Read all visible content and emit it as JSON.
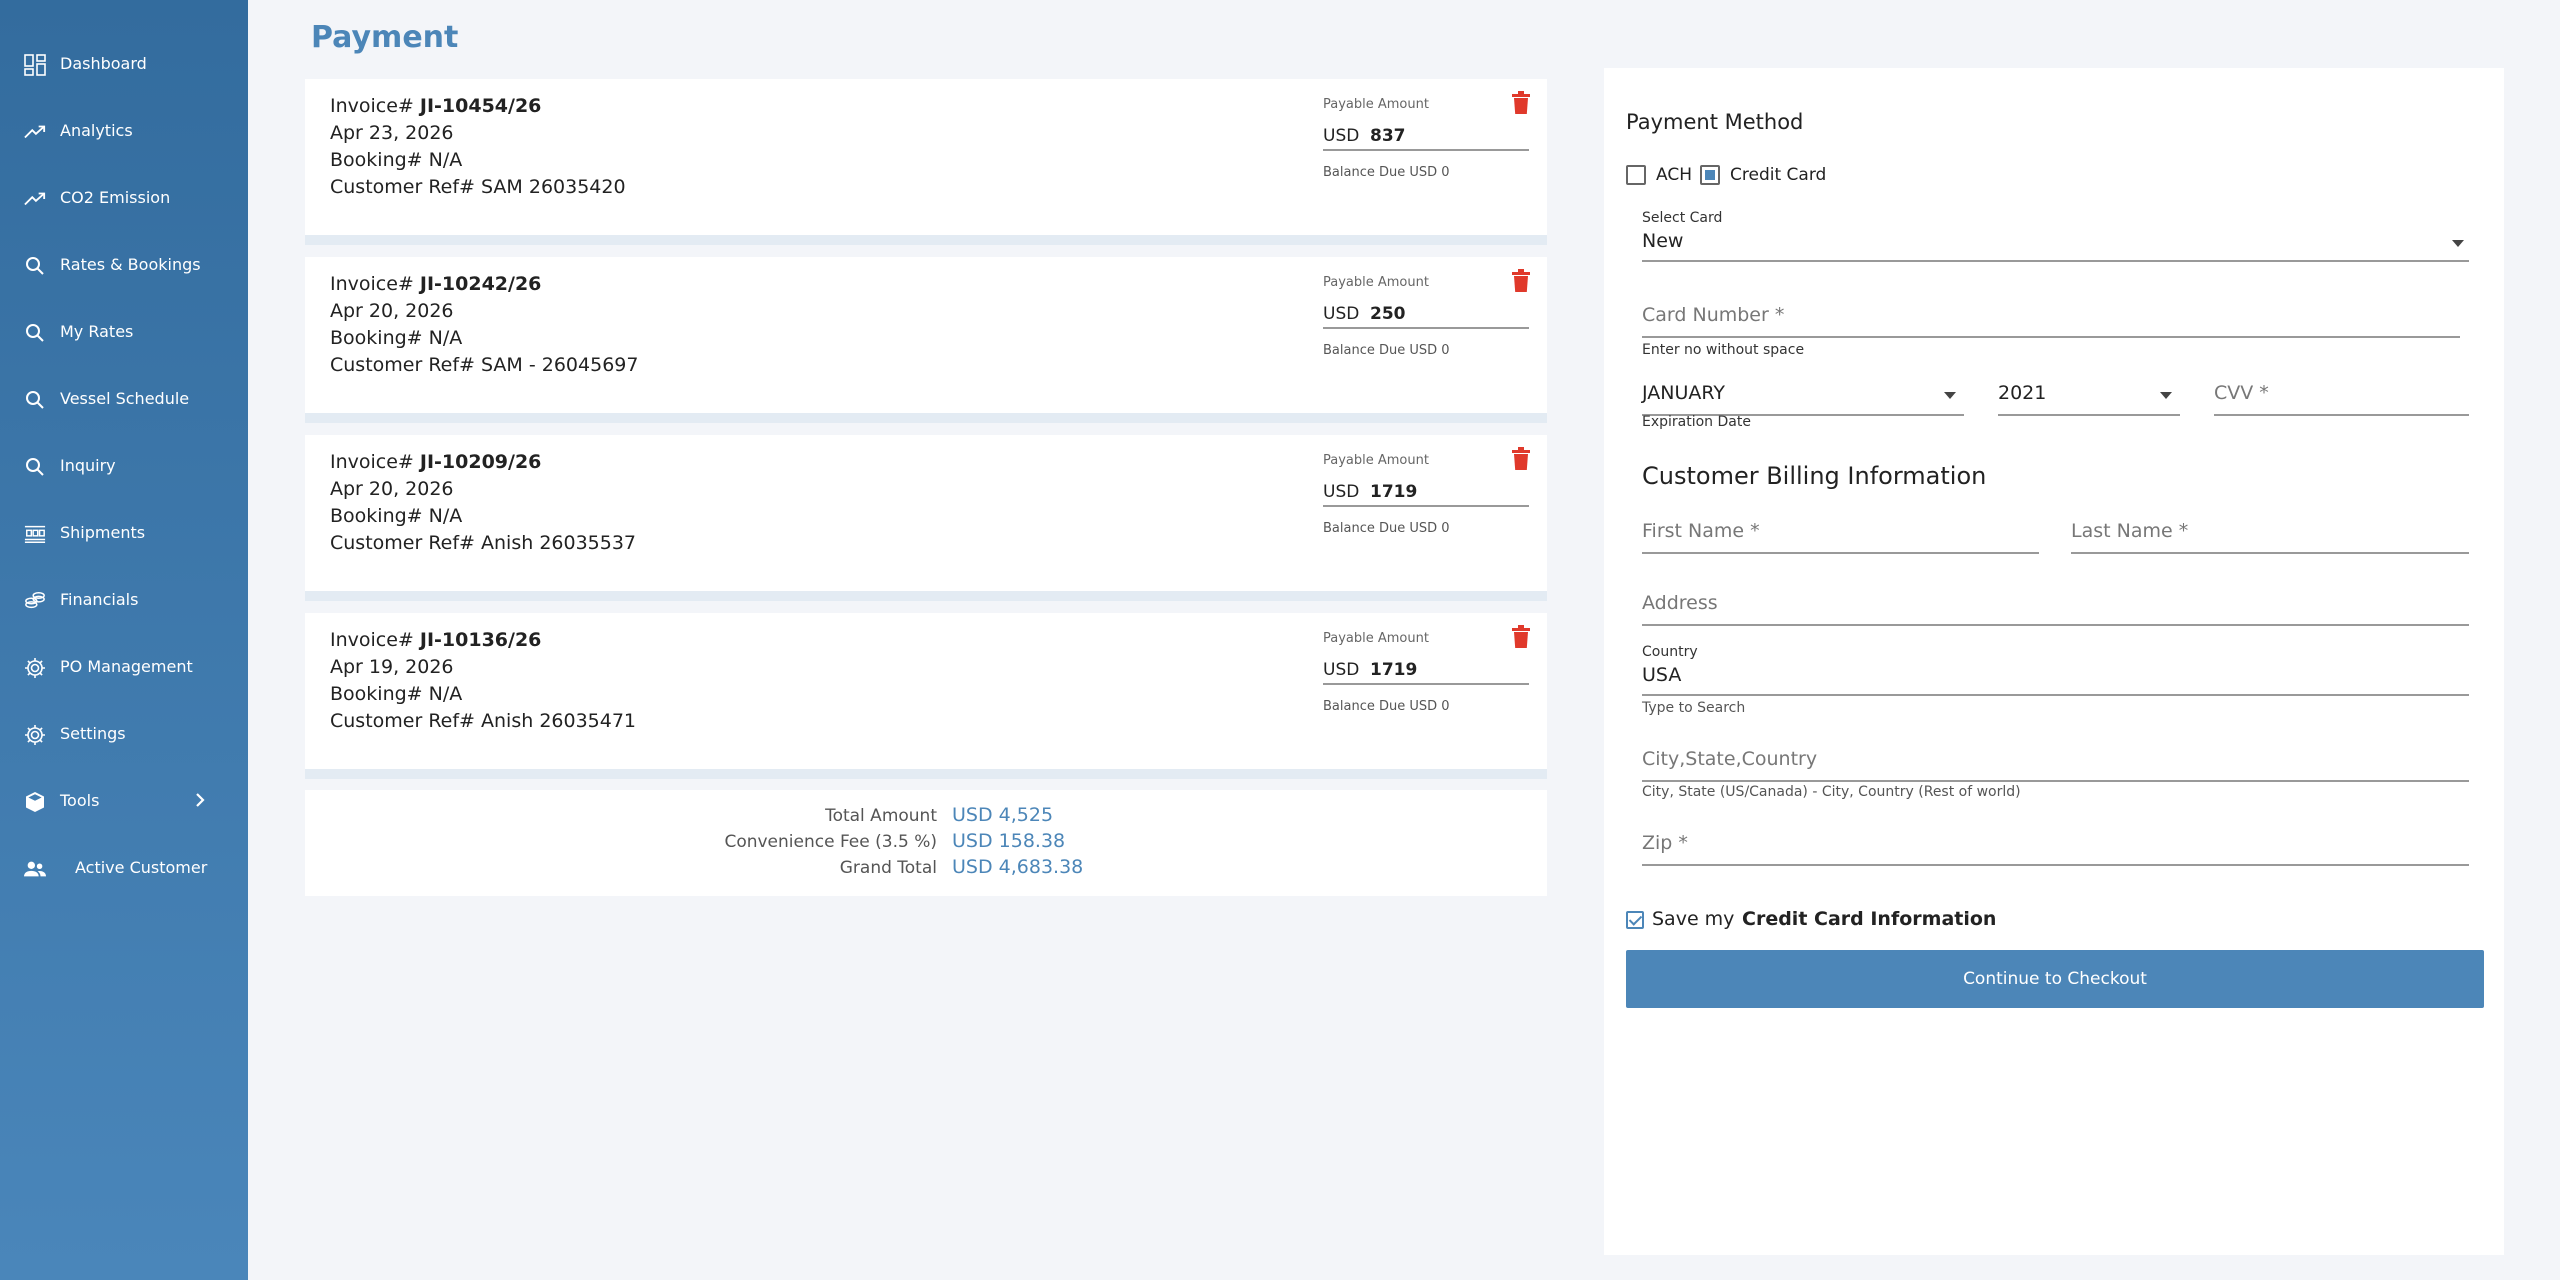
{
  "sidebar": {
    "items": [
      {
        "label": "Dashboard",
        "icon": "dashboard-icon"
      },
      {
        "label": "Analytics",
        "icon": "trend-icon"
      },
      {
        "label": "CO2 Emission",
        "icon": "trend-icon"
      },
      {
        "label": "Rates & Bookings",
        "icon": "search-icon"
      },
      {
        "label": "My Rates",
        "icon": "search-icon"
      },
      {
        "label": "Vessel Schedule",
        "icon": "search-icon"
      },
      {
        "label": "Inquiry",
        "icon": "search-icon"
      },
      {
        "label": "Shipments",
        "icon": "shipments-icon"
      },
      {
        "label": "Financials",
        "icon": "financials-icon"
      },
      {
        "label": "PO Management",
        "icon": "gear-icon"
      },
      {
        "label": "Settings",
        "icon": "gear-icon"
      },
      {
        "label": "Tools",
        "icon": "box-icon"
      },
      {
        "label": "Active Customer",
        "icon": "users-icon"
      }
    ]
  },
  "page": {
    "title": "Payment"
  },
  "invoices": [
    {
      "prefix": "Invoice# ",
      "number": "JI-10454/26",
      "date": "Apr 23, 2026",
      "booking": "Booking# N/A",
      "customer_ref": "Customer Ref# SAM 26035420",
      "payable_label": "Payable Amount",
      "currency": "USD",
      "amount": "837",
      "balance": "Balance Due USD 0"
    },
    {
      "prefix": "Invoice# ",
      "number": "JI-10242/26",
      "date": "Apr 20, 2026",
      "booking": "Booking# N/A",
      "customer_ref": "Customer Ref# SAM - 26045697",
      "payable_label": "Payable Amount",
      "currency": "USD",
      "amount": "250",
      "balance": "Balance Due USD 0"
    },
    {
      "prefix": "Invoice# ",
      "number": "JI-10209/26",
      "date": "Apr 20, 2026",
      "booking": "Booking# N/A",
      "customer_ref": "Customer Ref# Anish 26035537",
      "payable_label": "Payable Amount",
      "currency": "USD",
      "amount": "1719",
      "balance": "Balance Due USD 0"
    },
    {
      "prefix": "Invoice# ",
      "number": "JI-10136/26",
      "date": "Apr 19, 2026",
      "booking": "Booking# N/A",
      "customer_ref": "Customer Ref# Anish 26035471",
      "payable_label": "Payable Amount",
      "currency": "USD",
      "amount": "1719",
      "balance": "Balance Due USD 0"
    }
  ],
  "totals": {
    "total_label": "Total Amount",
    "total_value": "USD 4,525",
    "fee_label": "Convenience Fee (3.5 %)",
    "fee_value": "USD 158.38",
    "grand_label": "Grand Total",
    "grand_value": "USD 4,683.38"
  },
  "payment": {
    "title": "Payment Method",
    "ach_label": "ACH",
    "cc_label": "Credit Card",
    "select_card_label": "Select Card",
    "select_card_value": "New",
    "card_number_placeholder": "Card Number *",
    "card_number_helper": "Enter no without space",
    "exp_month": "JANUARY",
    "exp_year": "2021",
    "cvv_placeholder": "CVV *",
    "expiration_helper": "Expiration Date"
  },
  "billing": {
    "title": "Customer Billing Information",
    "first_name_placeholder": "First Name *",
    "last_name_placeholder": "Last Name *",
    "address_placeholder": "Address",
    "country_label": "Country",
    "country_value": "USA",
    "country_helper": "Type to Search",
    "city_placeholder": "City,State,Country",
    "city_helper": "City, State (US/Canada) - City, Country (Rest of world)",
    "zip_placeholder": "Zip *"
  },
  "save": {
    "text": "Save my",
    "bold": "Credit Card Information"
  },
  "checkout": {
    "label": "Continue to Checkout"
  },
  "colors": {
    "accent": "#4c86b8",
    "sidebar_top": "#336c9e",
    "sidebar_bottom": "#4a86ba",
    "delete": "#e0392b"
  }
}
